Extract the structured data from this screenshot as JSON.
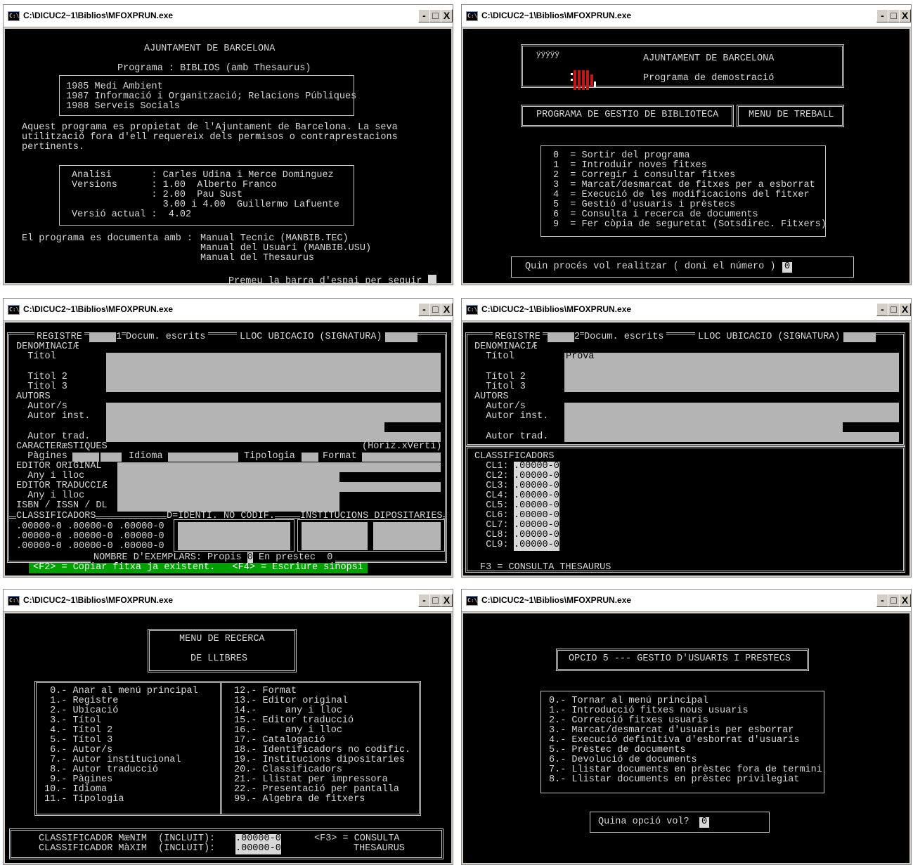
{
  "title_icon": "C:\\",
  "controls": {
    "min": "-",
    "max": "□",
    "close": "X"
  },
  "windows": [
    {
      "title": "C:\\DICUC2~1\\Biblios\\MFOXPRUN.exe"
    },
    {
      "title": "C:\\DICUC2~1\\Biblios\\MFOXPRUN.exe"
    },
    {
      "title": "C:\\DICUC2~1\\Biblios\\MFOXPRUN.exe"
    },
    {
      "title": "C:\\DICUC2~1\\Biblios\\MFOXPRUN.exe"
    },
    {
      "title": "C:\\DICUC2~1\\Biblios\\MFOXPRUN.exe"
    },
    {
      "title": "C:\\DICUC2~1\\Biblios\\MFOXPRUN.exe"
    }
  ],
  "w1": {
    "org": "AJUNTAMENT DE BARCELONA",
    "program": "Programa : BIBLIOS (amb Thesaurus)",
    "history": [
      "1985 Medi Ambient",
      "1987 Informació i Organització; Relacions Públiques",
      "1988 Serveis Socials"
    ],
    "notice": [
      "Aquest programa es propietat de l'Ajuntament de Barcelona. La seva",
      "utilització fora d'ell requereix dels permisos o contraprestacions",
      "pertinents."
    ],
    "credits": [
      "Analisi       : Carles Udina i Merce Dominguez",
      "Versions      : 1.00  Alberto Franco",
      "              : 2.00  Pau Sust",
      "                3.00 i 4.00  Guillermo Lafuente",
      "Versió actual :  4.02"
    ],
    "doc_label": "El programa es documenta amb :",
    "docs": [
      "Manual Tecnic (MANBIB.TEC)",
      "Manual del Usuari (MANBIB.USU)",
      "Manual del Thesaurus"
    ],
    "prompt": "Premeu la barra d'espai per seguir"
  },
  "w2": {
    "logo": "ÿÿÿÿÿ",
    "org": "AJUNTAMENT DE BARCELONA",
    "demo": "Programa de demostració",
    "app": "PROGRAMA DE GESTIO DE BIBLIOTECA",
    "menu_title": "MENU DE TREBALL",
    "options": [
      "0  = Sortir del programa",
      "1  = Introduir noves fitxes",
      "2  = Corregir i consultar fitxes",
      "3  = Marcat/desmarcat de fitxes per a esborrat",
      "4  = Execució de les modificacions del fitxer",
      "5  = Gestió d'usuaris i prèstecs",
      "6  = Consulta i recerca de documents",
      "9  = Fer còpia de seguretat (Sotsdirec. Fitxers)"
    ],
    "prompt": "Quin procés vol realitzar ( doni el número )",
    "value": "0"
  },
  "w3": {
    "registre": "REGISTRE",
    "reg_no": "1",
    "docum": "Docum. escrits",
    "lloc": "LLOC UBICACIO (SIGNATURA)",
    "labels": [
      "DENOMINACIÆ",
      "  Títol",
      "",
      "  Títol 2",
      "  Títol 3",
      "AUTORS",
      "  Autor/s",
      "  Autor inst.",
      "",
      "  Autor trad.",
      "CARACTERæSTIQUES",
      "  Pàgines",
      "EDITOR ORIGINAL",
      "  Any i lloc",
      "EDITOR TRADUCCIÆ",
      "  Any i lloc",
      "ISBN / ISSN / DL"
    ],
    "horiz": "(Horiz.xVerti)",
    "idioma": "Idioma",
    "tipologia": "Tipologia",
    "format": "Format",
    "classif_hdr": "CLASSIFICADORS",
    "ident_hdr": "D=IDENTI. NO CODIF.",
    "inst_hdr": "INSTITUCIONS DIPOSITARIES",
    "classif_rows": [
      ".00000-0 .00000-0 .00000-0",
      ".00000-0 .00000-0 .00000-0",
      ".00000-0 .00000-0 .00000-0"
    ],
    "exemplars": "NOMBRE D'EXEMPLARS: Propis",
    "propis": "0",
    "prestec": "En prestec",
    "prestec_val": "0",
    "keys": "<F2> = Copiar fitxa ja existent.   <F4> = Escriure sinopsi"
  },
  "w4": {
    "registre": "REGISTRE",
    "reg_no": "2",
    "docum": "Docum. escrits",
    "lloc": "LLOC UBICACIO (SIGNATURA)",
    "labels": [
      "DENOMINACIÆ",
      "  Títol",
      "",
      "  Títol 2",
      "  Títol 3",
      "AUTORS",
      "  Autor/s",
      "  Autor inst.",
      "",
      "  Autor trad."
    ],
    "titol_value": "Prova",
    "classif_hdr": "CLASSIFICADORS",
    "cl_labels": [
      "  CL1:",
      "  CL2:",
      "  CL3:",
      "  CL4:",
      "  CL5:",
      "  CL6:",
      "  CL7:",
      "  CL8:",
      "  CL9:"
    ],
    "cl_value": ".00000-0",
    "footer": "F3 = CONSULTA THESAURUS"
  },
  "w5": {
    "title1": "MENU DE RECERCA",
    "title2": "DE LLIBRES",
    "left": [
      " 0.- Anar al menú principal",
      " 1.- Registre",
      " 2.- Ubicació",
      " 3.- Títol",
      " 4.- Títol 2",
      " 5.- Títol 3",
      " 6.- Autor/s",
      " 7.- Autor institucional",
      " 8.- Autor traducció",
      " 9.- Pàgines",
      "10.- Idioma",
      "11.- Tipologia"
    ],
    "right": [
      "12.- Format",
      "13.- Editor original",
      "14.-     any i lloc",
      "15.- Editor traducció",
      "16.-     any i lloc",
      "17.- Catalogació",
      "18.- Identificadors no codific.",
      "19.- Institucions dipositaries",
      "20.- Classificadors",
      "21.- Llistat per impressora",
      "22.- Presentació per pantalla",
      "99.- Algebra de fitxers"
    ],
    "min_label": "CLASSIFICADOR MæNIM  (INCLUIT):",
    "max_label": "CLASSIFICADOR MàXIM  (INCLUIT):",
    "value": ".00000-0",
    "f3": "<F3> = CONSULTA",
    "thes": "THESAURUS"
  },
  "w6": {
    "title": "OPCIO 5 --- GESTIO D'USUARIS I PRESTECS",
    "options": [
      "0.- Tornar al menú principal",
      "1.- Introducció fitxes nous usuaris",
      "2.- Correcció fitxes usuaris",
      "3.- Marcat/desmarcat d'usuaris per esborrar",
      "4.- Execució definitiva d'esborrat d'usuaris",
      "5.- Prèstec de documents",
      "6.- Devolució de documents",
      "7.- Llistar documents en prèstec fora de termini",
      "8.- Llistar documents en prèstec privilegiat"
    ],
    "prompt": "Quina opció vol?",
    "value": "0"
  }
}
